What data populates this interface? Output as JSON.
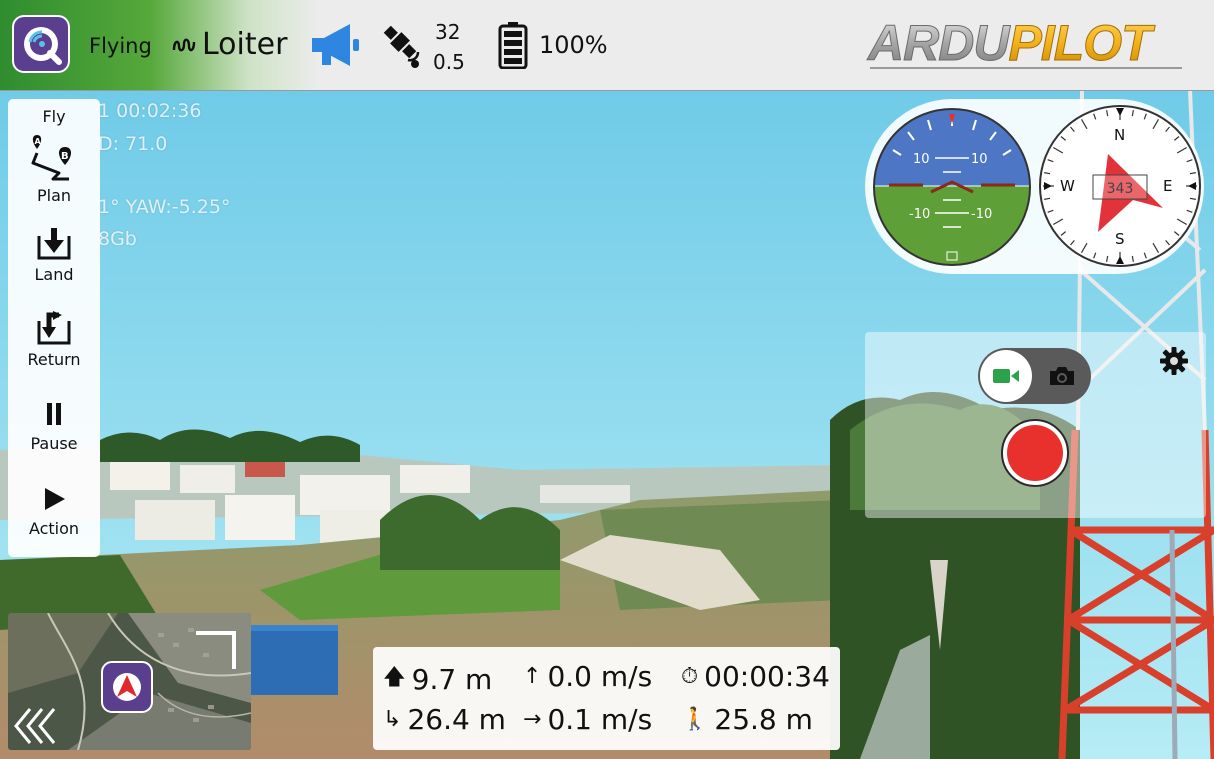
{
  "toolbar": {
    "flight_status": "Flying",
    "flight_mode": "Loiter",
    "gps_satellites": "32",
    "gps_hdop": "0.5",
    "battery_percent": "100%",
    "brand": "ARDUPILOT",
    "colors": {
      "brand_grey": "#a9a9a9",
      "brand_gold": "#f3b21b",
      "megaphone": "#2f86e0",
      "app_logo": "#5b3f8f"
    }
  },
  "overlay_text": {
    "line1": "1 00:02:36",
    "line2": "D: 71.0",
    "line3": "1° YAW:-5.25°",
    "line4": "8Gb"
  },
  "toolstrip": {
    "items": [
      {
        "label": "Fly",
        "icon": "none"
      },
      {
        "label": "Plan",
        "icon": "route-ab-icon"
      },
      {
        "label": "Land",
        "icon": "land-icon"
      },
      {
        "label": "Return",
        "icon": "return-icon"
      },
      {
        "label": "Pause",
        "icon": "pause-icon"
      },
      {
        "label": "Action",
        "icon": "play-icon"
      }
    ]
  },
  "attitude": {
    "pitch_labels": [
      "10",
      "10",
      "-10",
      "-10"
    ]
  },
  "compass": {
    "heading": "343",
    "n": "N",
    "e": "E",
    "s": "S",
    "w": "W"
  },
  "camera": {
    "mode": "video",
    "record_color": "#e8312d"
  },
  "telemetry": {
    "altitude": "9.7 m",
    "vertical_speed": "0.0 m/s",
    "flight_time": "00:00:34",
    "distance": "26.4 m",
    "horizontal_speed": "0.1 m/s",
    "home_distance": "25.8 m"
  }
}
